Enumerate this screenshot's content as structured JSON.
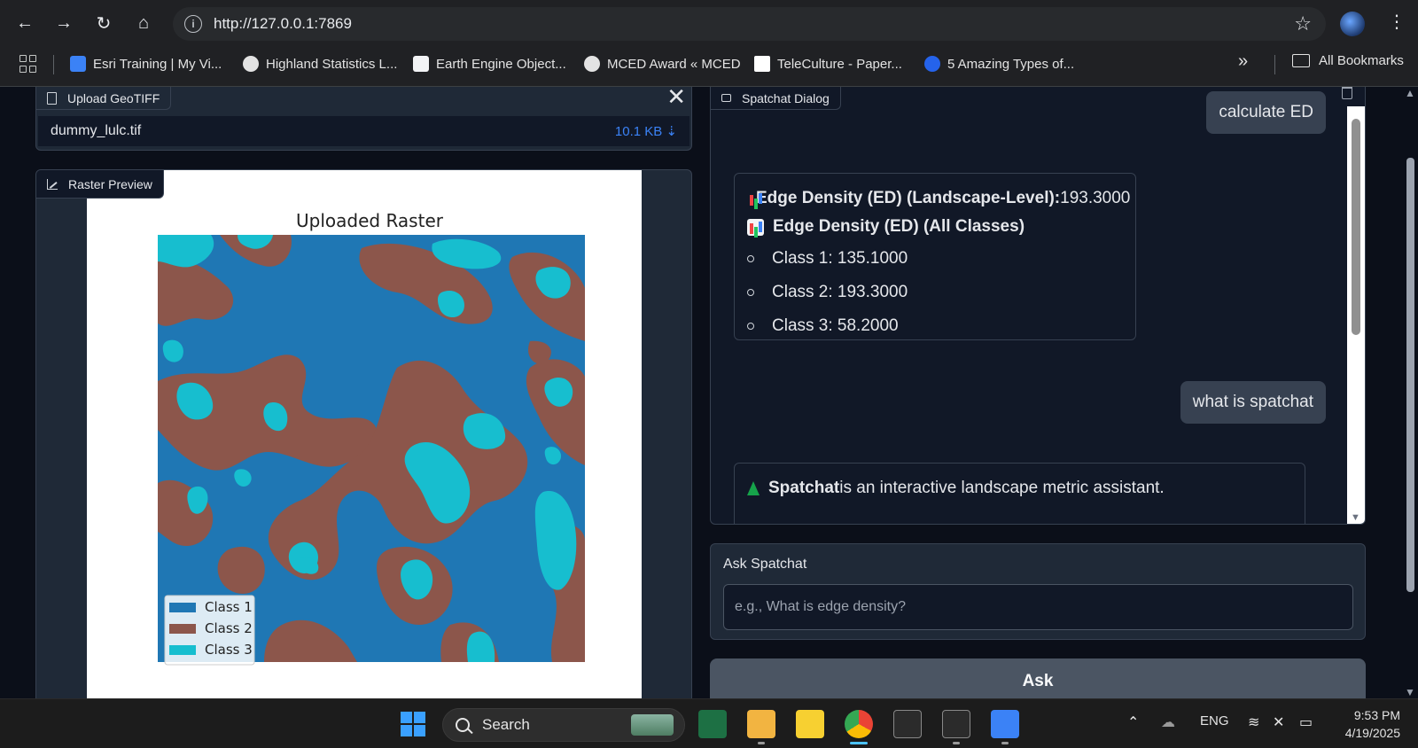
{
  "browser": {
    "url": "http://127.0.0.1:7869",
    "bookmarks": [
      "Esri Training | My Vi...",
      "Highland Statistics L...",
      "Earth Engine Object...",
      "MCED Award « MCED",
      "TeleCulture - Paper...",
      "5 Amazing Types of..."
    ],
    "more_label": "»",
    "all_bookmarks": "All Bookmarks"
  },
  "upload": {
    "label": "Upload GeoTIFF",
    "file_name": "dummy_lulc.tif",
    "file_size": "10.1 KB ⇣"
  },
  "preview": {
    "label": "Raster Preview",
    "plot_title": "Uploaded Raster",
    "legend": [
      {
        "label": "Class 1",
        "color": "#1f77b4"
      },
      {
        "label": "Class 2",
        "color": "#8c564b"
      },
      {
        "label": "Class 3",
        "color": "#17becf"
      }
    ]
  },
  "chat": {
    "label": "Spatchat Dialog",
    "messages": {
      "user1": "calculate ED",
      "bot1_line1_bold": "Edge Density (ED) (Landscape-Level):",
      "bot1_line1_value": " 193.3000",
      "bot1_line2_bold": "Edge Density (ED) (All Classes)",
      "bot1_items": [
        "Class 1: 135.1000",
        "Class 2: 193.3000",
        "Class 3: 58.2000"
      ],
      "user2": "what is spatchat",
      "bot2_bold": "Spatchat",
      "bot2_rest": " is an interactive landscape metric assistant."
    }
  },
  "ask": {
    "label": "Ask Spatchat",
    "placeholder": "e.g., What is edge density?",
    "button": "Ask"
  },
  "taskbar": {
    "search": "Search",
    "lang": "ENG",
    "time": "9:53 PM",
    "date": "4/19/2025"
  }
}
